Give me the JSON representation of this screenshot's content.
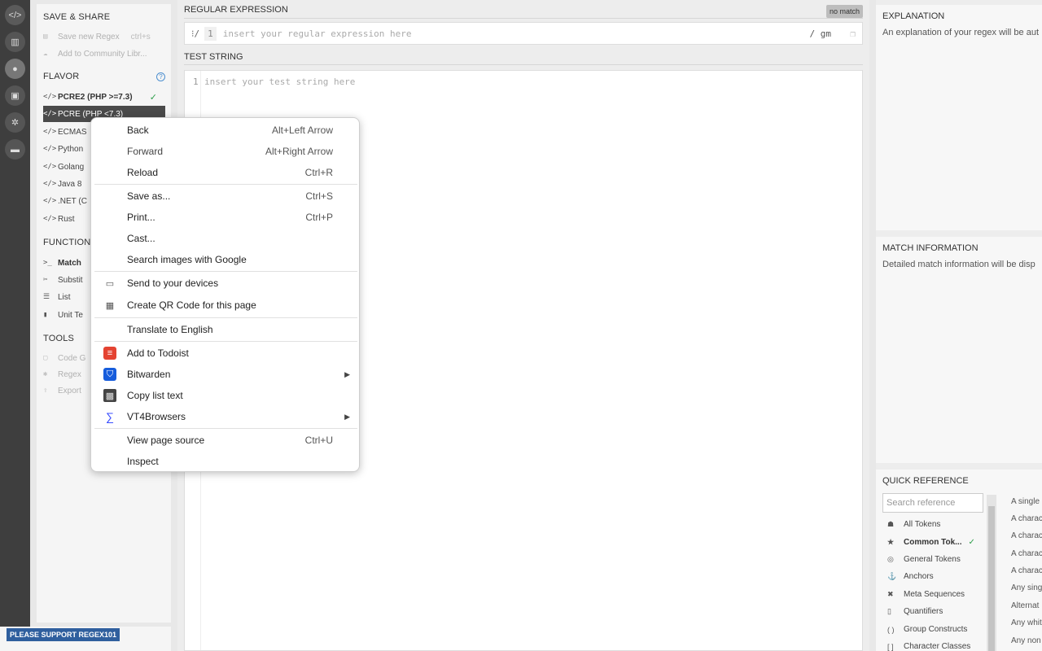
{
  "rail": {
    "icons": [
      "code-icon",
      "library-icon",
      "avatar",
      "gamepad-icon",
      "settings-icon",
      "chat-icon"
    ]
  },
  "sidebar": {
    "save_share": {
      "title": "SAVE & SHARE",
      "save_label": "Save new Regex",
      "save_shortcut": "ctrl+s",
      "community_label": "Add to Community Libr..."
    },
    "flavor": {
      "title": "FLAVOR",
      "help": "?",
      "items": [
        "PCRE2 (PHP >=7.3)",
        "PCRE (PHP <7.3)",
        "ECMAS",
        "Python",
        "Golang",
        "Java 8",
        ".NET (C",
        "Rust"
      ]
    },
    "function": {
      "title": "FUNCTION",
      "items": [
        "Match",
        "Substit",
        "List",
        "Unit Te"
      ]
    },
    "tools": {
      "title": "TOOLS",
      "items": [
        "Code G",
        "Regex",
        "Export"
      ]
    },
    "support_label": "PLEASE SUPPORT REGEX101"
  },
  "main": {
    "regex_label": "REGULAR EXPRESSION",
    "no_match": "no match",
    "delimiter_open": "/",
    "line_number": "1",
    "regex_placeholder": "insert your regular expression here",
    "flags": "/ gm",
    "test_label": "TEST STRING",
    "test_line": "1",
    "test_placeholder": "insert your test string here"
  },
  "right": {
    "explanation_title": "EXPLANATION",
    "explanation_text": "An explanation of your regex will be aut",
    "match_title": "MATCH INFORMATION",
    "match_text": "Detailed match information will be disp",
    "qr_title": "QUICK REFERENCE",
    "qr_search_placeholder": "Search reference",
    "qr_items": [
      {
        "icon": "all-tokens-icon",
        "label": "All Tokens"
      },
      {
        "icon": "star-icon",
        "label": "Common Tok..."
      },
      {
        "icon": "target-icon",
        "label": "General Tokens"
      },
      {
        "icon": "anchor-icon",
        "label": "Anchors"
      },
      {
        "icon": "meta-icon",
        "label": "Meta Sequences"
      },
      {
        "icon": "quantifier-icon",
        "label": "Quantifiers"
      },
      {
        "icon": "group-icon",
        "label": "Group Constructs"
      },
      {
        "icon": "bracket-icon",
        "label": "Character Classes"
      }
    ],
    "qr_desc": [
      "A single",
      "A charac",
      "A charac",
      "A charac",
      "A charac",
      "Any sing",
      "Alternat",
      "Any whit",
      "Any non"
    ]
  },
  "context_menu": {
    "items": [
      {
        "label": "Back",
        "shortcut": "Alt+Left Arrow"
      },
      {
        "label": "Forward",
        "shortcut": "Alt+Right Arrow"
      },
      {
        "label": "Reload",
        "shortcut": "Ctrl+R"
      },
      {
        "label": "Save as...",
        "shortcut": "Ctrl+S"
      },
      {
        "label": "Print...",
        "shortcut": "Ctrl+P"
      },
      {
        "label": "Cast...",
        "shortcut": ""
      },
      {
        "label": "Search images with Google",
        "shortcut": ""
      },
      {
        "label": "Send to your devices",
        "shortcut": ""
      },
      {
        "label": "Create QR Code for this page",
        "shortcut": ""
      },
      {
        "label": "Translate to English",
        "shortcut": ""
      },
      {
        "label": "Add to Todoist",
        "shortcut": ""
      },
      {
        "label": "Bitwarden",
        "shortcut": ""
      },
      {
        "label": "Copy list text",
        "shortcut": ""
      },
      {
        "label": "VT4Browsers",
        "shortcut": ""
      },
      {
        "label": "View page source",
        "shortcut": "Ctrl+U"
      },
      {
        "label": "Inspect",
        "shortcut": ""
      }
    ]
  },
  "colors": {
    "rail": "#3e3e3e",
    "selected": "#4a4a4a",
    "check": "#2e9e4b",
    "support_badge": "#2f5f9e",
    "todoist": "#e44332",
    "bitwarden": "#175ddc",
    "vt4browsers": "#394eff"
  }
}
